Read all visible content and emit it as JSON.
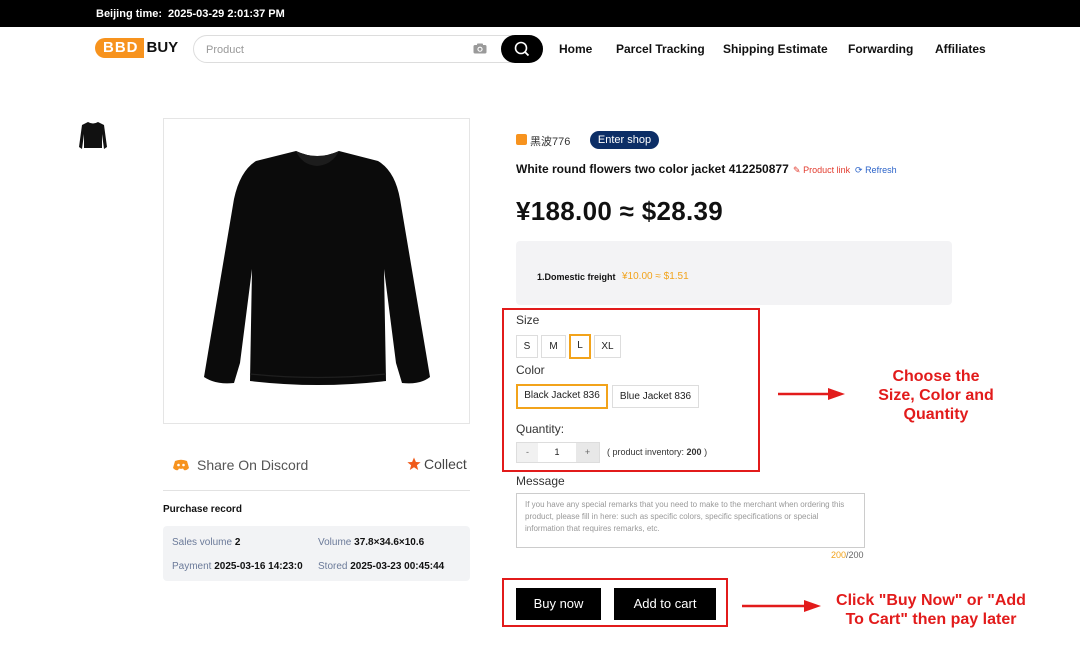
{
  "topbar": {
    "label": "Beijing time:",
    "time": "2025-03-29 2:01:37 PM"
  },
  "logo": {
    "part1": "BBD",
    "part2": "BUY"
  },
  "search": {
    "placeholder": "Product"
  },
  "nav": {
    "items": [
      "Home",
      "Parcel Tracking",
      "Shipping Estimate",
      "Forwarding",
      "Affiliates"
    ]
  },
  "shop": {
    "name": "黑波776",
    "enter_label": "Enter shop"
  },
  "product": {
    "title": "White round flowers two color jacket 412250877",
    "link_label": "Product link",
    "refresh_label": "Refresh",
    "price": "¥188.00 ≈ $28.39"
  },
  "freight": {
    "label": "1.Domestic freight",
    "value": "¥10.00 ≈ $1.51"
  },
  "size": {
    "label": "Size",
    "options": [
      "S",
      "M",
      "L",
      "XL"
    ],
    "selected": "L"
  },
  "color": {
    "label": "Color",
    "options": [
      "Black Jacket 836",
      "Blue Jacket 836"
    ],
    "selected": "Black Jacket 836"
  },
  "quantity": {
    "label": "Quantity:",
    "minus": "-",
    "value": "1",
    "plus": "+",
    "inventory_prefix": "( product inventory: ",
    "inventory_value": "200",
    "inventory_suffix": " )"
  },
  "message": {
    "label": "Message",
    "placeholder": "If you have any special remarks that you need to make to the merchant when ordering this product, please fill in here: such as specific colors, specific specifications or special information that requires remarks, etc.",
    "count_current": "200",
    "count_max": "/200"
  },
  "share": {
    "label": "Share On Discord"
  },
  "collect": {
    "label": "Collect"
  },
  "purchase": {
    "title": "Purchase record",
    "sales_label": "Sales volume",
    "sales_value": "2",
    "volume_label": "Volume",
    "volume_value": "37.8×34.6×10.6",
    "payment_label": "Payment",
    "payment_value": "2025-03-16 14:23:0",
    "stored_label": "Stored",
    "stored_value": "2025-03-23 00:45:44"
  },
  "buttons": {
    "buy_now": "Buy now",
    "add_to_cart": "Add to cart"
  },
  "annotations": {
    "choose_1": "Choose the",
    "choose_2": "Size, Color and",
    "choose_3": "Quantity",
    "click_1": "Click \"Buy Now\" or \"Add",
    "click_2": "To Cart\" then pay later"
  },
  "colors": {
    "accent": "#f2a31b",
    "brand_orange": "#f7931e",
    "annotation_red": "#e21b1b",
    "shop_button": "#0c2e66",
    "discord": "#f7931e"
  },
  "icons": [
    "camera-icon",
    "search-icon",
    "shop-icon",
    "link-icon",
    "refresh-icon",
    "discord-icon",
    "star-icon",
    "arrow-icon"
  ]
}
